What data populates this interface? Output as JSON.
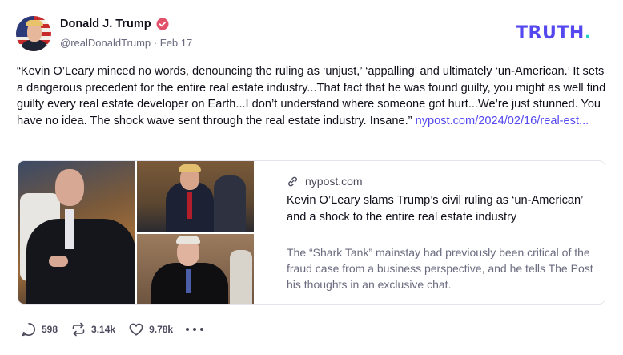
{
  "author": {
    "display_name": "Donald J. Trump",
    "handle": "@realDonaldTrump",
    "separator": "·",
    "date": "Feb 17",
    "verified_color": "#e2506a"
  },
  "brand": {
    "logo_text": "TRUTH",
    "logo_dot": ".",
    "logo_color": "#5448ee",
    "dot_color": "#1fd3c3"
  },
  "post": {
    "text": "“Kevin O’Leary minced no words, denouncing the ruling as ‘unjust,’ ‘appalling’ and ultimately ‘un-American.’ It sets a dangerous precedent for the entire real estate industry...That fact that he was found guilty, you might as well find guilty every real estate developer on Earth...I don’t understand where someone got hurt...We’re just stunned. You have no idea. The shock wave sent through the real estate industry. Insane.”",
    "link_text": "nypost.com/2024/02/16/real-est..."
  },
  "card": {
    "domain": "nypost.com",
    "title": "Kevin O’Leary slams Trump’s civil ruling as ‘un-American’ and a shock to the entire real estate industry",
    "description": "The “Shark Tank” mainstay had previously been critical of the fraud case from a business perspective, and he tells The Post his thoughts in an exclusive chat."
  },
  "actions": {
    "replies": "598",
    "retruths": "3.14k",
    "likes": "9.78k"
  },
  "icons": {
    "verified": "verified-badge-icon",
    "link": "link-icon",
    "reply": "reply-icon",
    "retruth": "retruth-icon",
    "like": "heart-icon",
    "more": "more-icon"
  }
}
